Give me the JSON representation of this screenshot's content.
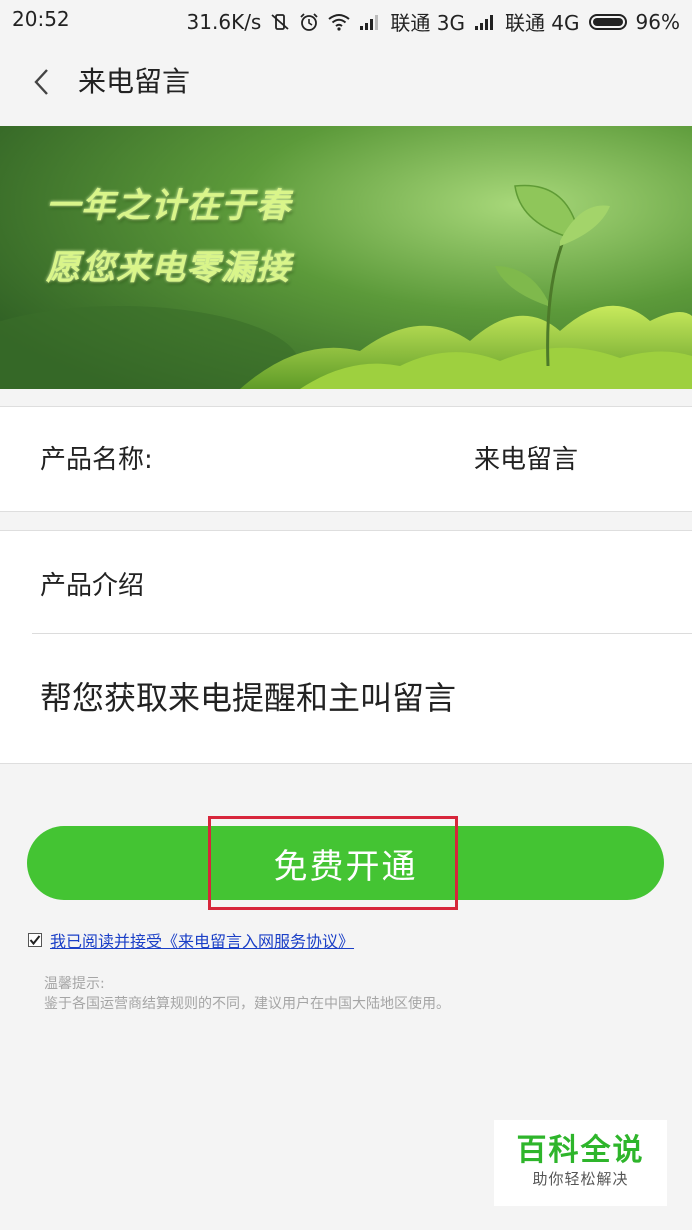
{
  "status_bar": {
    "time": "20:52",
    "speed": "31.6K/s",
    "carrier1": "联通 3G",
    "carrier2": "联通 4G",
    "battery": "96%"
  },
  "header": {
    "title": "来电留言"
  },
  "banner": {
    "line1": "一年之计在于春",
    "line2": "愿您来电零漏接"
  },
  "product": {
    "name_label": "产品名称:",
    "name_value": "来电留言",
    "intro_label": "产品介绍",
    "intro_text": "帮您获取来电提醒和主叫留言"
  },
  "action": {
    "open_label": "免费开通"
  },
  "agreement": {
    "checked": true,
    "text": "我已阅读并接受《来电留言入网服务协议》"
  },
  "tips": {
    "title": "温馨提示:",
    "text": "鉴于各国运营商结算规则的不同，建议用户在中国大陆地区使用。"
  },
  "watermark": {
    "title": "百科全说",
    "subtitle": "助你轻松解决"
  },
  "colors": {
    "primary_button": "#44c433",
    "highlight_box": "#d7263b",
    "link": "#1a3fc7"
  }
}
